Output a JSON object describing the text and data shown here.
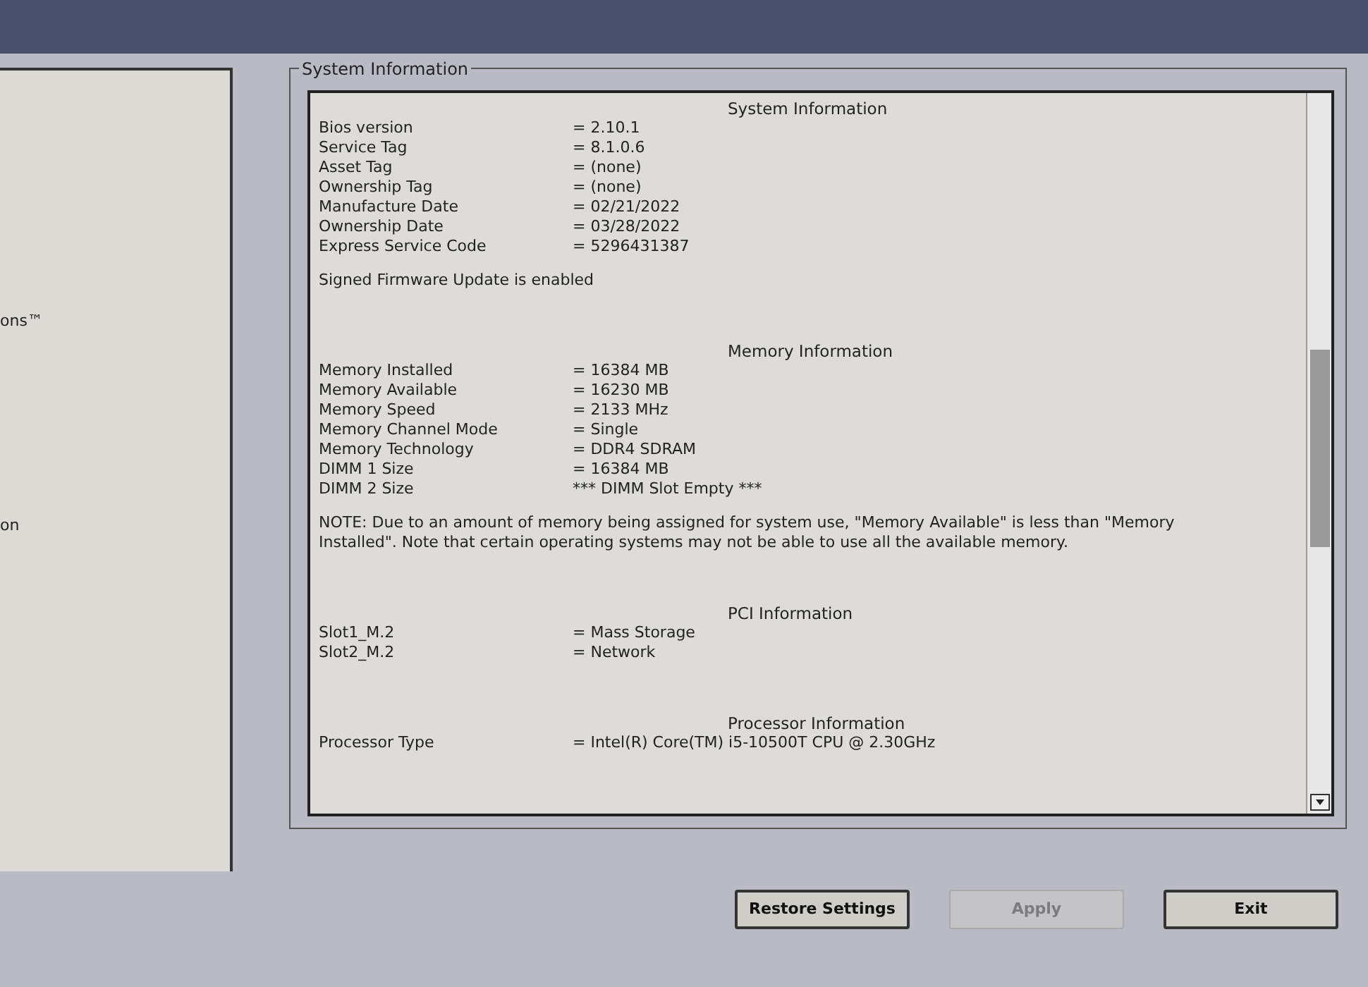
{
  "sidebar": {
    "items": [
      {
        "label": "ons™"
      },
      {
        "label": "on"
      }
    ]
  },
  "group": {
    "title": "System Information"
  },
  "sections": [
    {
      "heading": "System Information",
      "rows": [
        {
          "label": "Bios version",
          "value": "= 2.10.1"
        },
        {
          "label": "Service Tag",
          "value": "= 8.1.0.6"
        },
        {
          "label": "Asset Tag",
          "value": "= (none)"
        },
        {
          "label": "Ownership Tag",
          "value": "= (none)"
        },
        {
          "label": "Manufacture Date",
          "value": "= 02/21/2022"
        },
        {
          "label": "Ownership Date",
          "value": "= 03/28/2022"
        },
        {
          "label": "Express Service Code",
          "value": "= 5296431387"
        }
      ],
      "note": "Signed Firmware Update is enabled"
    },
    {
      "heading": "Memory Information",
      "rows": [
        {
          "label": "Memory Installed",
          "value": "= 16384 MB"
        },
        {
          "label": "Memory Available",
          "value": "= 16230 MB"
        },
        {
          "label": "Memory Speed",
          "value": "= 2133 MHz"
        },
        {
          "label": "Memory Channel Mode",
          "value": "= Single"
        },
        {
          "label": "Memory Technology",
          "value": "= DDR4 SDRAM"
        },
        {
          "label": "DIMM 1 Size",
          "value": "= 16384 MB"
        },
        {
          "label": "DIMM 2 Size",
          "value": "*** DIMM Slot Empty ***"
        }
      ],
      "note": "NOTE: Due to an amount of memory being assigned for system use, \"Memory Available\" is less than \"Memory Installed\". Note that certain operating systems may not be able to use all the available memory."
    },
    {
      "heading": "PCI Information",
      "rows": [
        {
          "label": "Slot1_M.2",
          "value": "= Mass Storage"
        },
        {
          "label": "Slot2_M.2",
          "value": "= Network"
        }
      ]
    },
    {
      "heading": "Processor Information",
      "rows": [
        {
          "label": "Processor Type",
          "value": "= Intel(R) Core(TM) i5-10500T CPU @ 2.30GHz"
        }
      ]
    }
  ],
  "buttons": [
    {
      "label": "Restore Settings",
      "disabled": false
    },
    {
      "label": "Apply",
      "disabled": true
    },
    {
      "label": "Exit",
      "disabled": false
    }
  ]
}
